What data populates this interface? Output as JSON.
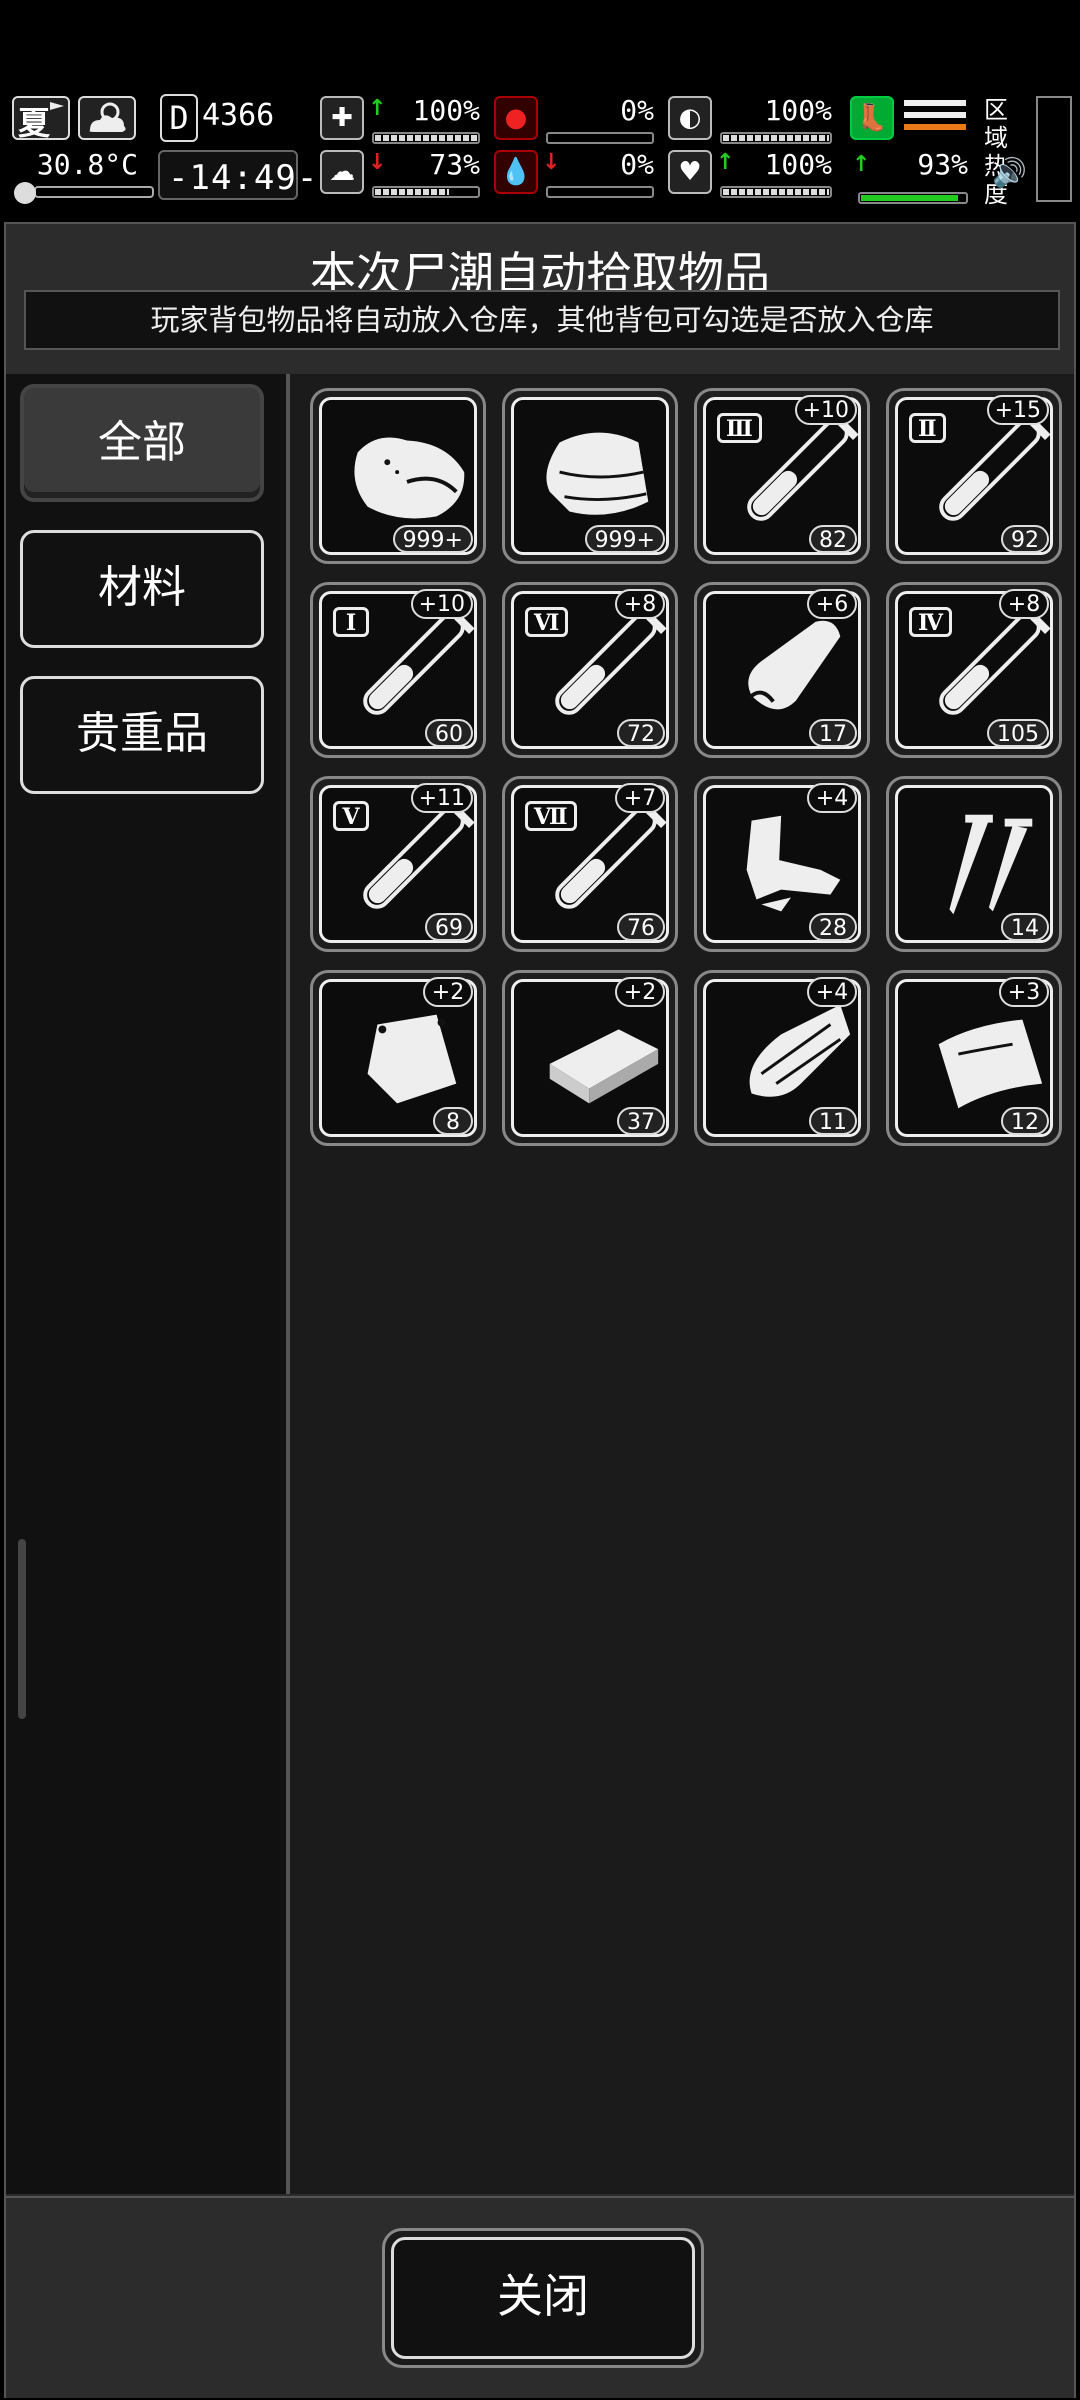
{
  "hud": {
    "season": "夏",
    "temperature": "30.8°C",
    "day_prefix": "D",
    "day_number": "4366",
    "time": "-14:49-",
    "stats": [
      {
        "icon": "medkit-icon",
        "arrow": "up",
        "arrow_color": "#22cc22",
        "value": "100%",
        "fill": 1.0
      },
      {
        "icon": "stomach-icon",
        "arrow": "",
        "arrow_color": "",
        "value": "0%",
        "fill": 0.0
      },
      {
        "icon": "pill-icon",
        "arrow": "",
        "arrow_color": "",
        "value": "100%",
        "fill": 1.0
      },
      {
        "icon": "brain-icon",
        "arrow": "down",
        "arrow_color": "#dd2222",
        "value": "73%",
        "fill": 0.73
      },
      {
        "icon": "blood-drop-icon",
        "arrow": "down",
        "arrow_color": "#dd2222",
        "value": "0%",
        "fill": 0.0
      },
      {
        "icon": "heart-icon",
        "arrow": "up",
        "arrow_color": "#22cc22",
        "value": "100%",
        "fill": 1.0
      }
    ],
    "stamina": {
      "value": "93%",
      "fill": 0.93,
      "color": "#22cc22"
    },
    "region_label": "区域\n热度"
  },
  "panel": {
    "title": "本次尸潮自动拾取物品",
    "subtitle": "玩家背包物品将自动放入仓库，其他背包可勾选是否放入仓库"
  },
  "tabs": [
    {
      "label": "全部",
      "active": true
    },
    {
      "label": "材料",
      "active": false
    },
    {
      "label": "贵重品",
      "active": false
    }
  ],
  "items": [
    {
      "name": "meat",
      "icon": "meat-icon",
      "count": "999+",
      "bonus": "",
      "tier": ""
    },
    {
      "name": "cloth",
      "icon": "cloth-icon",
      "count": "999+",
      "bonus": "",
      "tier": ""
    },
    {
      "name": "potion-3",
      "icon": "test-tube-icon",
      "count": "82",
      "bonus": "+10",
      "tier": "Ⅲ"
    },
    {
      "name": "potion-2",
      "icon": "test-tube-icon",
      "count": "92",
      "bonus": "+15",
      "tier": "Ⅱ"
    },
    {
      "name": "potion-1",
      "icon": "test-tube-icon",
      "count": "60",
      "bonus": "+10",
      "tier": "Ⅰ"
    },
    {
      "name": "potion-6",
      "icon": "test-tube-icon",
      "count": "72",
      "bonus": "+8",
      "tier": "Ⅵ"
    },
    {
      "name": "leather",
      "icon": "leather-icon",
      "count": "17",
      "bonus": "+6",
      "tier": ""
    },
    {
      "name": "potion-4",
      "icon": "test-tube-icon",
      "count": "105",
      "bonus": "+8",
      "tier": "Ⅳ"
    },
    {
      "name": "potion-5",
      "icon": "test-tube-icon",
      "count": "69",
      "bonus": "+11",
      "tier": "Ⅴ"
    },
    {
      "name": "potion-7",
      "icon": "test-tube-icon",
      "count": "76",
      "bonus": "+7",
      "tier": "Ⅶ"
    },
    {
      "name": "scrap-metal",
      "icon": "scrap-icon",
      "count": "28",
      "bonus": "+4",
      "tier": ""
    },
    {
      "name": "nails",
      "icon": "nails-icon",
      "count": "14",
      "bonus": "",
      "tier": ""
    },
    {
      "name": "bag",
      "icon": "bag-icon",
      "count": "8",
      "bonus": "+2",
      "tier": ""
    },
    {
      "name": "plank",
      "icon": "plank-icon",
      "count": "37",
      "bonus": "+2",
      "tier": ""
    },
    {
      "name": "wood",
      "icon": "wood-icon",
      "count": "11",
      "bonus": "+4",
      "tier": ""
    },
    {
      "name": "plastic",
      "icon": "plastic-sheet-icon",
      "count": "12",
      "bonus": "+3",
      "tier": ""
    }
  ],
  "close_label": "关闭"
}
